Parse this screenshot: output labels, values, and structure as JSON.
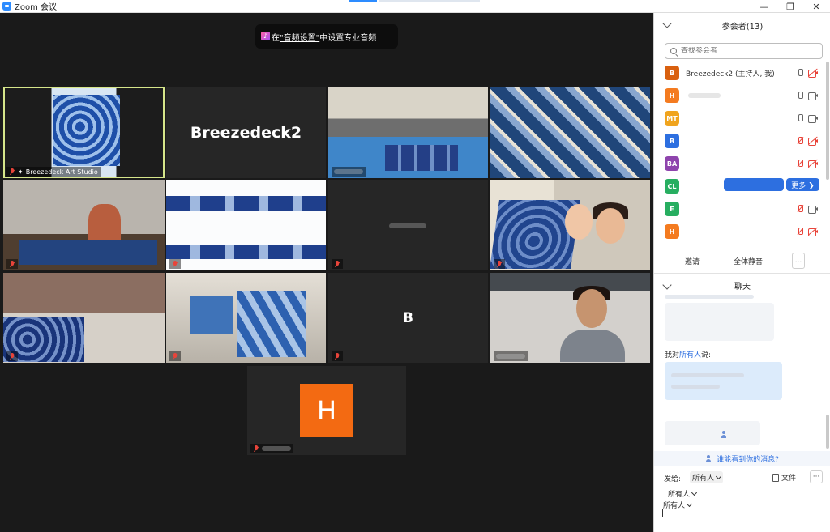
{
  "window": {
    "title": "Zoom 会议",
    "controls": {
      "minimize": "—",
      "restore": "❐",
      "close": "✕"
    }
  },
  "banner": {
    "prefix": "在",
    "link": "\"音频设置\"",
    "suffix": "中设置专业音频"
  },
  "tiles": [
    {
      "id": "t1",
      "label": "Breezedeck Art Studio",
      "scene": "dyed-fabric"
    },
    {
      "id": "t2",
      "display_name": "Breezedeck2"
    },
    {
      "id": "t3",
      "scene": "living-room-fabric"
    },
    {
      "id": "t4",
      "scene": "tie-dye-cloth"
    },
    {
      "id": "t5",
      "scene": "child-at-table"
    },
    {
      "id": "t6",
      "scene": "hanging-fabric"
    },
    {
      "id": "t7",
      "scene": "blurred-name"
    },
    {
      "id": "t8",
      "scene": "woman-and-child"
    },
    {
      "id": "t9",
      "scene": "bed-with-cloth"
    },
    {
      "id": "t10",
      "scene": "shirts-on-line"
    },
    {
      "id": "t11",
      "display_name": "B"
    },
    {
      "id": "t12",
      "scene": "woman-smiling"
    },
    {
      "id": "t13",
      "avatar_letter": "H"
    }
  ],
  "panel": {
    "participants_title": "参会者(13)",
    "search_placeholder": "查找参会者",
    "participants": [
      {
        "initials": "B",
        "color": "#d9600f",
        "name": "Breezedeck2 (主持人, 我)",
        "mic": "on",
        "cam": "off"
      },
      {
        "initials": "H",
        "color": "#f47b20",
        "name": "",
        "mic": "on",
        "cam": "on"
      },
      {
        "initials": "MT",
        "color": "#f0a41e",
        "name": "",
        "mic": "on",
        "cam": "on"
      },
      {
        "initials": "B",
        "color": "#2d6fe0",
        "name": "",
        "mic": "muted",
        "cam": "off"
      },
      {
        "initials": "BA",
        "color": "#8e44ad",
        "name": "",
        "mic": "muted",
        "cam": "off"
      },
      {
        "initials": "CL",
        "color": "#27ae60",
        "name": "",
        "mic": "",
        "cam": ""
      },
      {
        "initials": "E",
        "color": "#27ae60",
        "name": "",
        "mic": "muted",
        "cam": "on"
      },
      {
        "initials": "H",
        "color": "#f47b20",
        "name": "",
        "mic": "muted",
        "cam": "off"
      }
    ],
    "more_label": "更多 ❯",
    "invite_label": "邀请",
    "mute_all_label": "全体静音",
    "ellipsis_label": "...",
    "chat_title": "聊天",
    "chat_sender_prefix": "我对",
    "chat_sender_target": "所有人",
    "chat_sender_suffix": "说:",
    "visibility_label": "谁能看到你的消息?",
    "send_to_label": "发给:",
    "send_to_value": "所有人",
    "file_label": "文件",
    "dots_label": "···",
    "recipient_1": "所有人",
    "recipient_2": "所有人"
  }
}
